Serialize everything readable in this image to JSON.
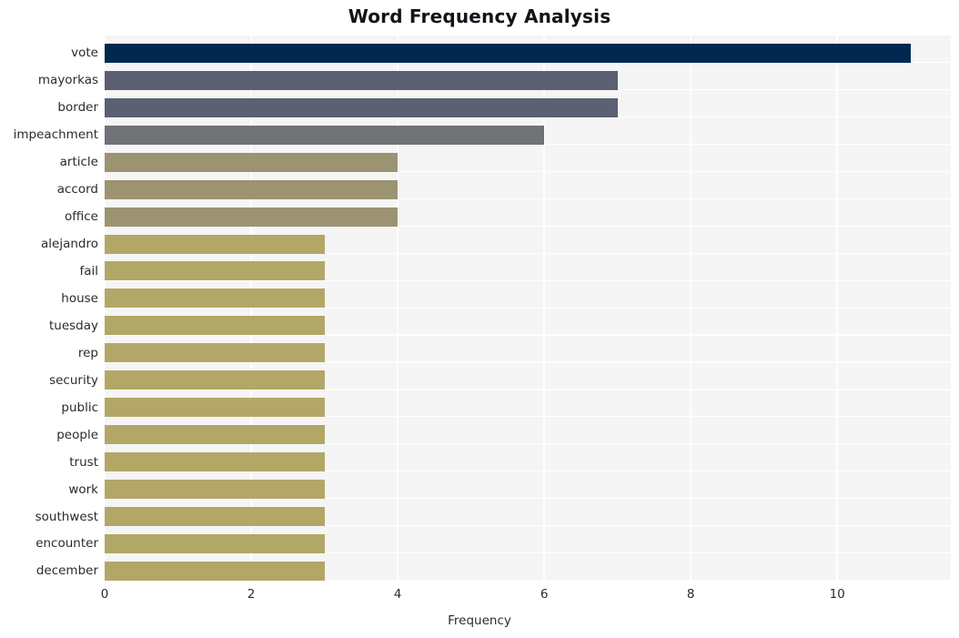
{
  "chart_data": {
    "type": "bar",
    "orientation": "horizontal",
    "title": "Word Frequency Analysis",
    "xlabel": "Frequency",
    "ylabel": "",
    "xlim": [
      0,
      11.55
    ],
    "xticks": [
      0,
      2,
      4,
      6,
      8,
      10
    ],
    "grid": true,
    "legend": null,
    "categories": [
      "vote",
      "mayorkas",
      "border",
      "impeachment",
      "article",
      "accord",
      "office",
      "alejandro",
      "fail",
      "house",
      "tuesday",
      "rep",
      "security",
      "public",
      "people",
      "trust",
      "work",
      "southwest",
      "encounter",
      "december"
    ],
    "values": [
      11,
      7,
      7,
      6,
      4,
      4,
      4,
      3,
      3,
      3,
      3,
      3,
      3,
      3,
      3,
      3,
      3,
      3,
      3,
      3
    ],
    "bar_colors": [
      "#002850",
      "#5b6072",
      "#5b6072",
      "#707277",
      "#9b9372",
      "#9b9372",
      "#9b9372",
      "#b3a767",
      "#b3a767",
      "#b3a767",
      "#b3a767",
      "#b3a767",
      "#b3a767",
      "#b3a767",
      "#b3a767",
      "#b3a767",
      "#b3a767",
      "#b3a767",
      "#b3a767",
      "#b3a767"
    ],
    "plot_background": "#f5f5f6",
    "grid_color": "#ffffff",
    "figure_background": "#ffffff",
    "text_color": "#2b2b2b"
  }
}
